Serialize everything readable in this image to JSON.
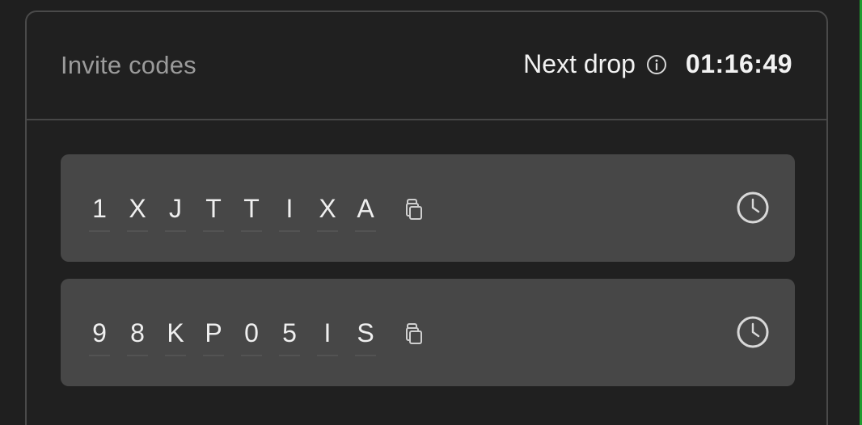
{
  "card": {
    "title": "Invite codes",
    "next_drop_label": "Next drop",
    "timer": "01:16:49"
  },
  "codes": [
    {
      "chars": [
        "1",
        "X",
        "J",
        "T",
        "T",
        "I",
        "X",
        "A"
      ]
    },
    {
      "chars": [
        "9",
        "8",
        "K",
        "P",
        "0",
        "5",
        "I",
        "S"
      ]
    }
  ],
  "icons": {
    "info": "info-icon",
    "copy": "copy-icon",
    "clock": "clock-icon"
  },
  "colors": {
    "background": "#1f1f1f",
    "row_background": "#474747",
    "accent": "#1f9d2f"
  }
}
